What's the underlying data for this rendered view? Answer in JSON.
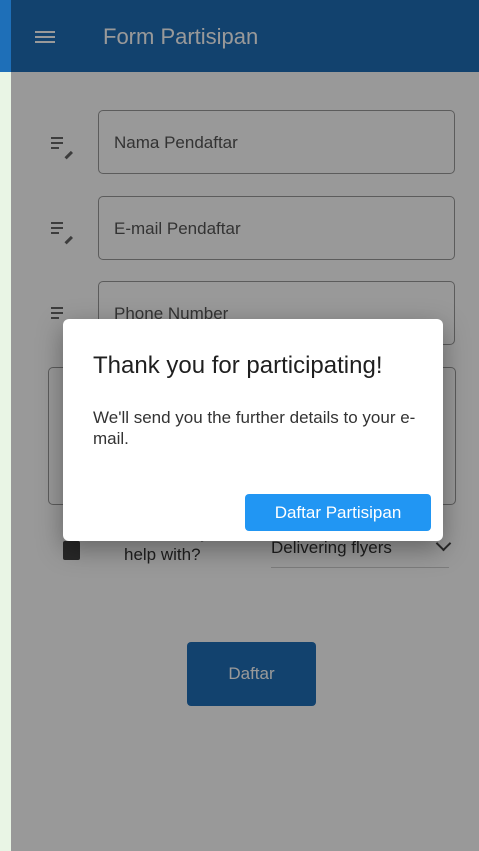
{
  "appbar": {
    "title": "Form Partisipan",
    "menu_icon": "hamburger-menu-icon",
    "color": "#1e6fb8"
  },
  "form": {
    "fields": [
      {
        "label": "Nama Pendaftar",
        "icon": "notes-edit-icon"
      },
      {
        "label": "E-mail Pendaftar",
        "icon": "notes-edit-icon"
      },
      {
        "label": "Phone Number",
        "icon": "notes-edit-icon"
      }
    ],
    "message_placeholder": "",
    "help_question": "What can you help with?",
    "help_icon": "clipboard-icon",
    "help_selected": "Delivering flyers",
    "submit_label": "Daftar"
  },
  "dialog": {
    "title": "Thank you for participating!",
    "body": "We'll send you the further details to your e-mail.",
    "button_label": "Daftar Partisipan",
    "button_color": "#2196f3"
  }
}
